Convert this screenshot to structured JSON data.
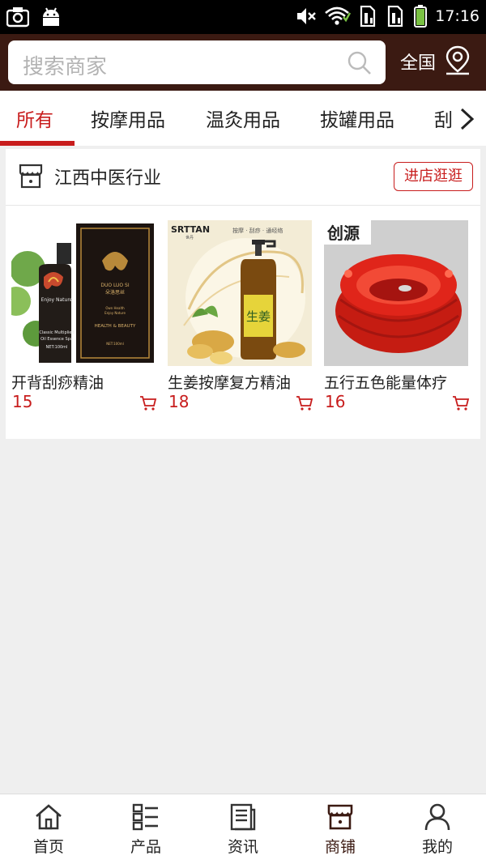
{
  "status_bar": {
    "time": "17:16",
    "icons": [
      "camera-icon",
      "android-icon",
      "mute-icon",
      "wifi-icon",
      "sim1-icon",
      "sim2-icon",
      "battery-icon"
    ]
  },
  "header": {
    "search_placeholder": "搜索商家",
    "region_label": "全国",
    "bg_color": "#3b1a12"
  },
  "tabs": {
    "items": [
      {
        "label": "所有",
        "active": true
      },
      {
        "label": "按摩用品",
        "active": false
      },
      {
        "label": "温灸用品",
        "active": false
      },
      {
        "label": "拔罐用品",
        "active": false
      },
      {
        "label": "刮痧用品",
        "active": false
      }
    ],
    "accent_color": "#c81d1d"
  },
  "shop": {
    "name": "江西中医行业",
    "visit_label": "进店逛逛",
    "products": [
      {
        "name": "开背刮痧精油",
        "price": "15",
        "image_text": [
          "Enjoy Nature",
          "Classic Multiplied",
          "Oil Essence Spa",
          "NET:100ml",
          "DUO LUO SI",
          "朵洛思丝",
          "Own Health",
          "Enjoy Nature",
          "HEALTH & BEAUTY",
          "NET:100ml"
        ]
      },
      {
        "name": "生姜按摩复方精油",
        "price": "18",
        "image_text": [
          "SRTTAN",
          "世丹",
          "按摩 · 刮痧 · 通经络",
          "生姜"
        ]
      },
      {
        "name": "五行五色能量体疗",
        "price": "16",
        "image_text": [
          "创源"
        ]
      }
    ]
  },
  "bottom_nav": [
    {
      "label": "首页",
      "icon": "home-icon",
      "active": false
    },
    {
      "label": "产品",
      "icon": "grid-list-icon",
      "active": false
    },
    {
      "label": "资讯",
      "icon": "news-icon",
      "active": false
    },
    {
      "label": "商铺",
      "icon": "store-icon",
      "active": true
    },
    {
      "label": "我的",
      "icon": "user-icon",
      "active": false
    }
  ]
}
